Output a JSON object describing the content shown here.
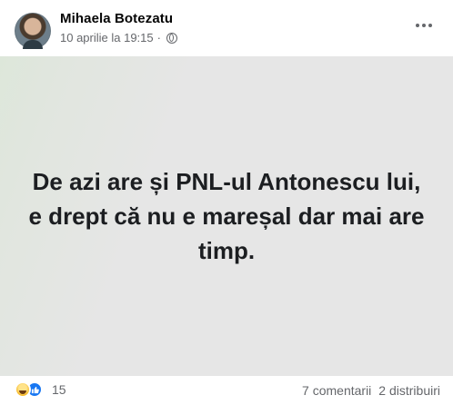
{
  "post": {
    "author": "Mihaela Botezatu",
    "timestamp": "10 aprilie la 19:15",
    "separator": "·",
    "privacy_icon": "globe-icon",
    "more_icon": "more-dots-icon",
    "text": "De azi are și PNL-ul Antonescu lui, e drept că nu e mareșal dar mai are timp.",
    "background_colors": [
      "#dde7da",
      "#e6e6e6"
    ]
  },
  "footer": {
    "reaction_icons": [
      "haha-icon",
      "like-icon"
    ],
    "reaction_count": "15",
    "comments_label": "7 comentarii",
    "shares_label": "2 distribuiri"
  }
}
